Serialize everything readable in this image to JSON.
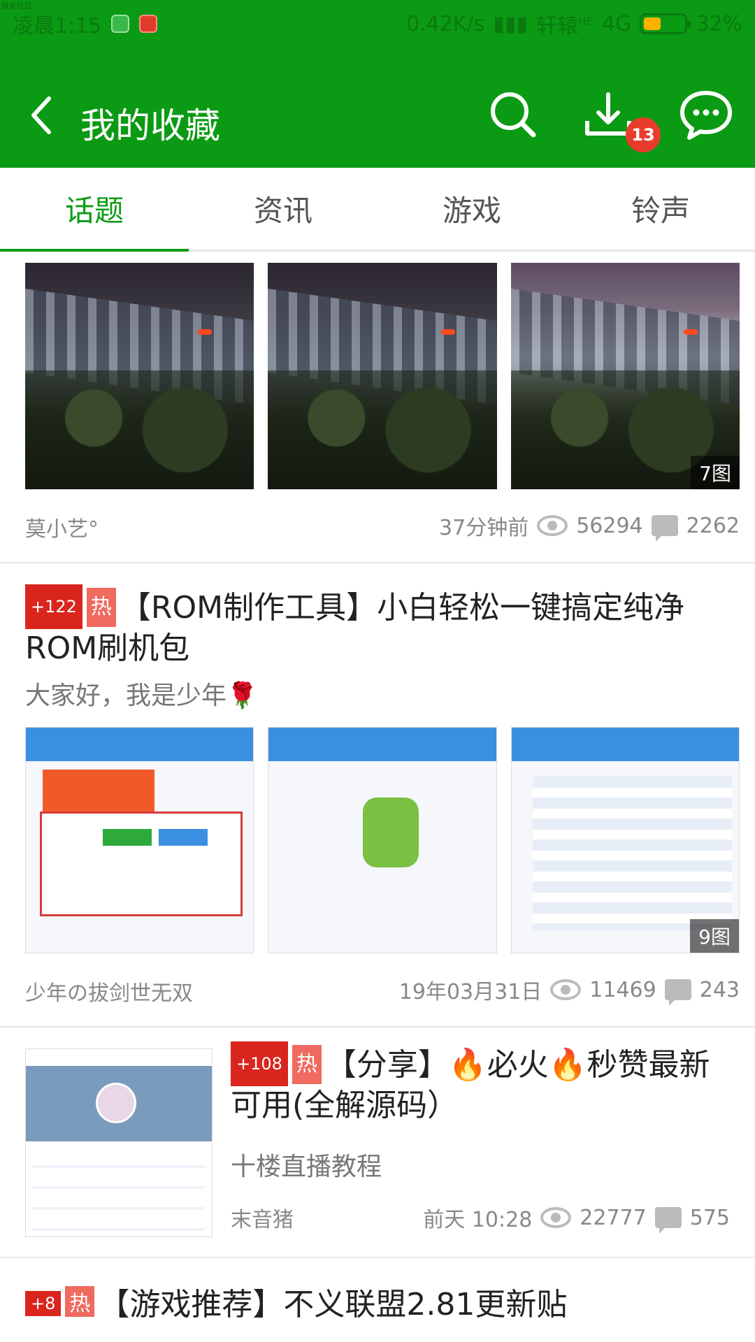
{
  "status": {
    "watermark": "锋友社区",
    "time": "凌晨1:15",
    "speed": "0.42K/s",
    "carrier": "轩辕",
    "carrier_sup": "HE",
    "network": "4G",
    "battery": "32%"
  },
  "header": {
    "title": "我的收藏",
    "download_badge": "13"
  },
  "tabs": [
    "话题",
    "资讯",
    "游戏",
    "铃声"
  ],
  "posts": [
    {
      "image_count": "7图",
      "author": "莫小艺°",
      "time": "37分钟前",
      "views": "56294",
      "comments": "2262"
    },
    {
      "tag_plus": "+122",
      "tag_hot": "热",
      "title": "【ROM制作工具】小白轻松一键搞定纯净ROM刷机包",
      "subtitle": "大家好，我是少年🌹",
      "image_count": "9图",
      "author": "少年の拔剑世无双",
      "time": "19年03月31日",
      "views": "11469",
      "comments": "243"
    },
    {
      "tag_plus": "+108",
      "tag_hot": "热",
      "title": "【分享】🔥必火🔥秒赞最新可用(全解源码）",
      "subtitle": "十楼直播教程",
      "author": "末音猪",
      "time": "前天 10:28",
      "views": "22777",
      "comments": "575"
    },
    {
      "tag_plus": "+8",
      "tag_hot": "热",
      "title": "【游戏推荐】不义联盟2.81更新贴"
    }
  ],
  "colors": {
    "brand_green": "#0b9a13",
    "tab_active": "#0e9b17",
    "badge_red": "#ea3c2d",
    "tag_red": "#d9251d"
  },
  "icons": [
    "back-arrow-icon",
    "search-icon",
    "download-icon",
    "chat-icon",
    "eye-icon",
    "comment-icon"
  ]
}
